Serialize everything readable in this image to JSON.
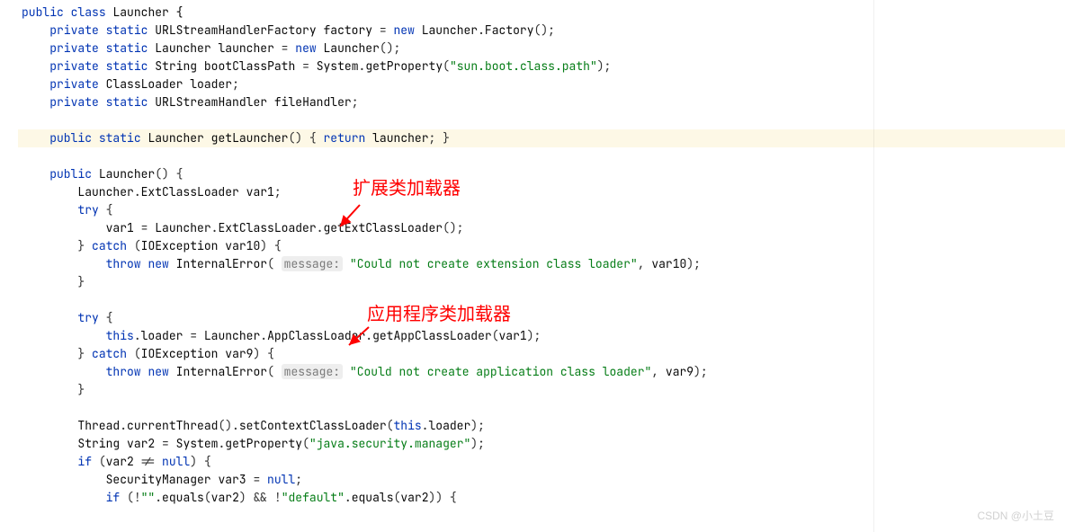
{
  "tokens": {
    "public": "public",
    "private": "private",
    "static": "static",
    "class": "class",
    "new": "new",
    "throw": "throw",
    "this": "this",
    "if": "if",
    "return": "return",
    "try": "try",
    "catch": "catch",
    "null": "null",
    "Launcher": "Launcher",
    "URLStreamHandlerFactory": "URLStreamHandlerFactory",
    "URLStreamHandler": "URLStreamHandler",
    "String": "String",
    "ClassLoader": "ClassLoader",
    "IOException": "IOException",
    "InternalError": "InternalError",
    "SecurityManager": "SecurityManager",
    "factory": "factory",
    "launcher": "launcher",
    "bootClassPath": "bootClassPath",
    "loader": "loader",
    "fileHandler": "fileHandler",
    "var1": "var1",
    "var2": "var2",
    "var3": "var3",
    "var9": "var9",
    "var10": "var10",
    "getLauncher": "getLauncher",
    "Factory": "Factory",
    "System": "System",
    "getProperty": "getProperty",
    "ExtClassLoader": "ExtClassLoader",
    "AppClassLoader": "AppClassLoader",
    "getExtClassLoader": "getExtClassLoader",
    "getAppClassLoader": "getAppClassLoader",
    "Thread": "Thread",
    "currentThread": "currentThread",
    "setContextClassLoader": "setContextClassLoader",
    "equals": "equals"
  },
  "strings": {
    "bootPath": "\"sun.boot.class.path\"",
    "extErr": "\"Could not create extension class loader\"",
    "appErr": "\"Could not create application class loader\"",
    "secMgr": "\"java.security.manager\"",
    "empty": "\"\"",
    "default": "\"default\""
  },
  "hints": {
    "message": "message:"
  },
  "annotations": {
    "ext": "扩展类加载器",
    "app": "应用程序类加载器"
  },
  "watermark": "CSDN @小土豆"
}
